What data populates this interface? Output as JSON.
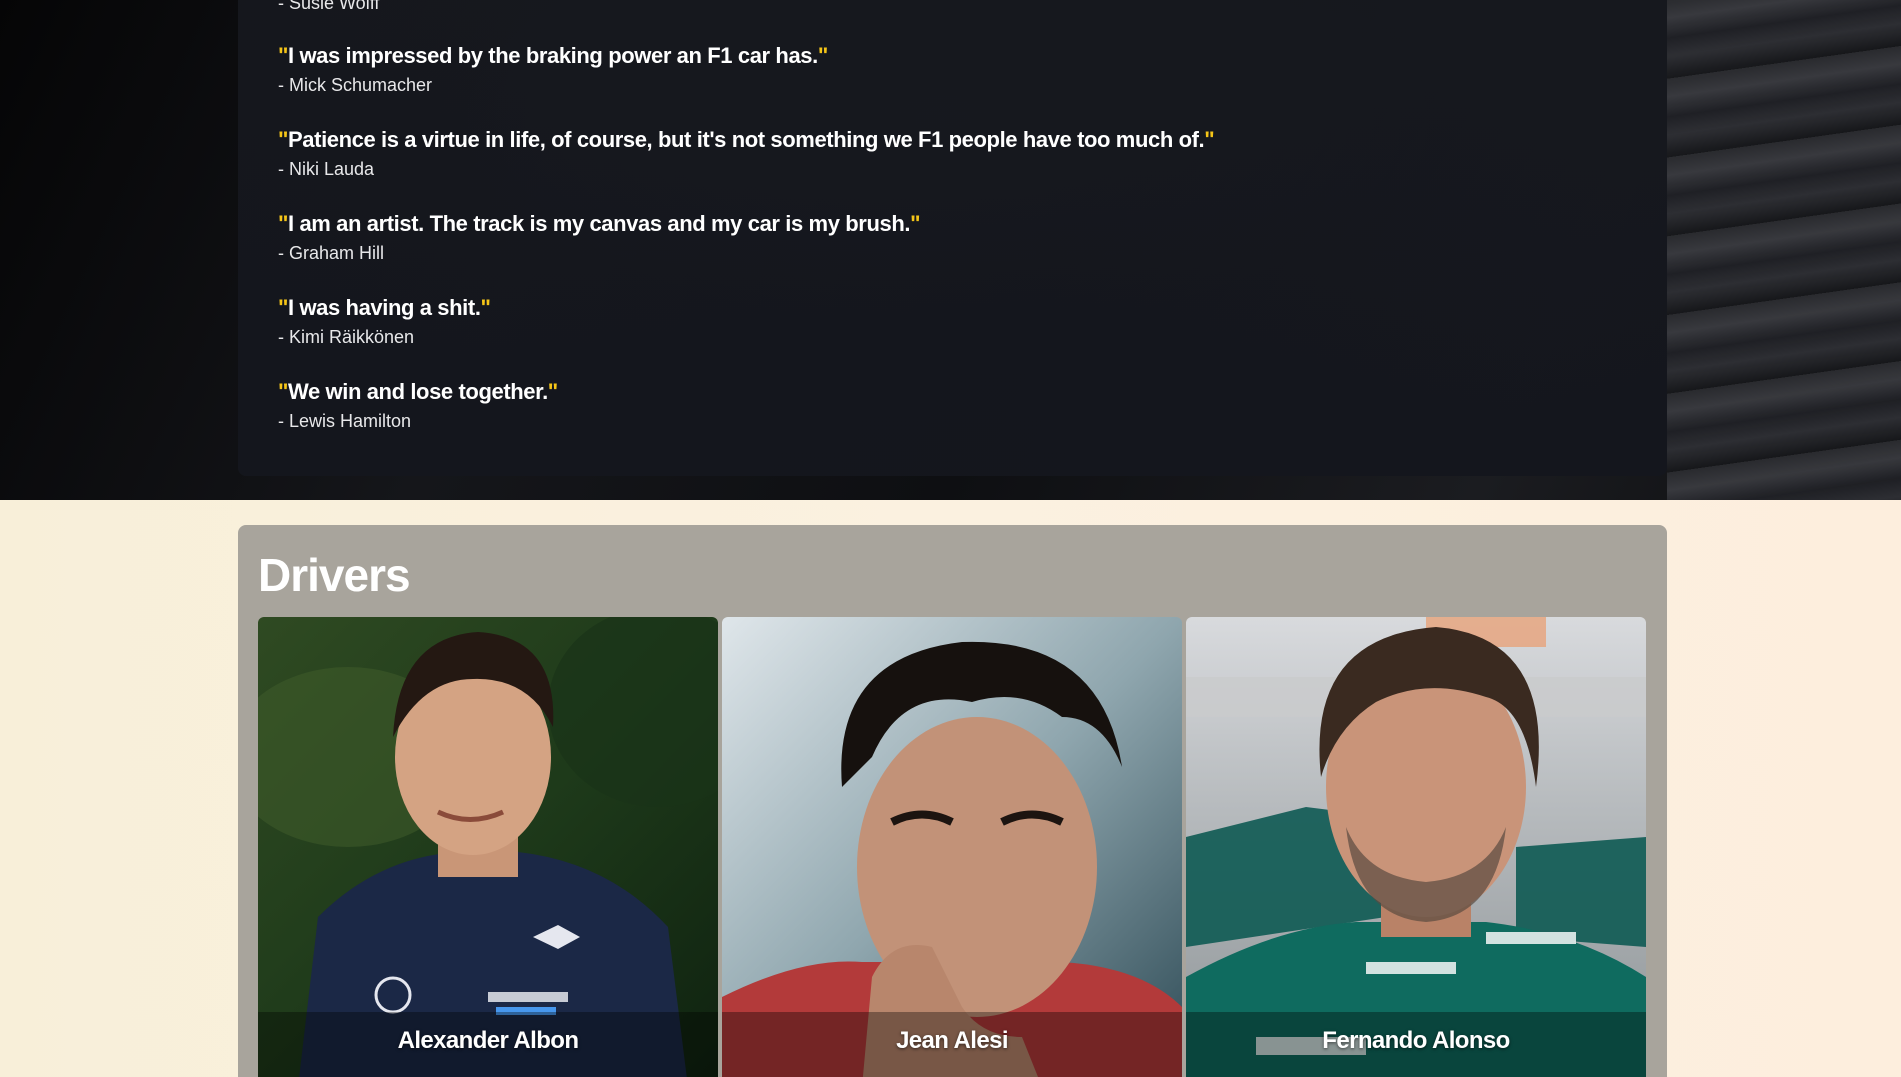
{
  "quotes": [
    {
      "text": "",
      "author": "- Susie Wolff"
    },
    {
      "text": "I was impressed by the braking power an F1 car has.",
      "author": "- Mick Schumacher"
    },
    {
      "text": "Patience is a virtue in life, of course, but it's not something we F1 people have too much of.",
      "author": "- Niki Lauda"
    },
    {
      "text": "I am an artist. The track is my canvas and my car is my brush.",
      "author": "- Graham Hill"
    },
    {
      "text": "I was having a shit.",
      "author": "- Kimi Räikkönen"
    },
    {
      "text": "We win and lose together.",
      "author": "- Lewis Hamilton"
    }
  ],
  "quote_mark": "\"",
  "drivers": {
    "title": "Drivers",
    "items": [
      {
        "name": "Alexander Albon",
        "photo": "driver-photo"
      },
      {
        "name": "Jean Alesi",
        "photo": "driver-photo"
      },
      {
        "name": "Fernando Alonso",
        "photo": "driver-photo"
      }
    ]
  },
  "colors": {
    "accent_quote_mark": "#f5c518",
    "dark_panel": "#16181e",
    "drivers_panel": "#a8a49c",
    "light_background": "#fbf1e0"
  }
}
